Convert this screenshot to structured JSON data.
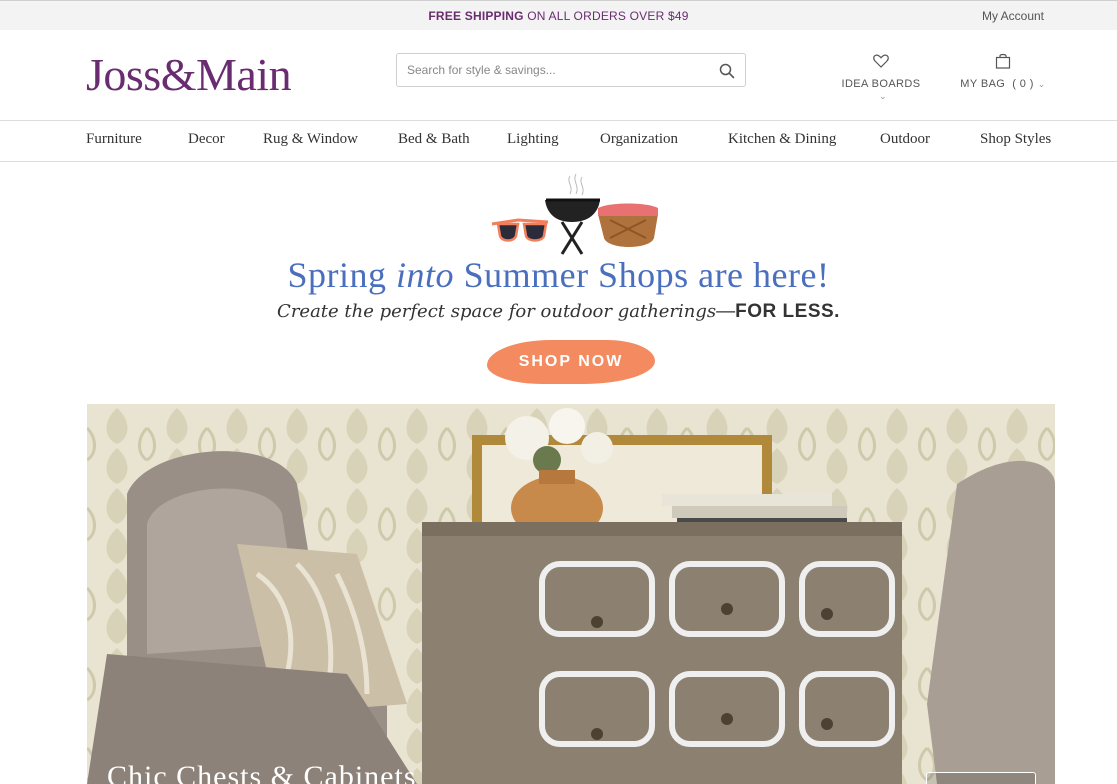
{
  "colors": {
    "brand": "#6a2c70",
    "hero_blue": "#4b6fbf",
    "shop_now": "#f48a5f"
  },
  "topbar": {
    "promo_bold": "FREE SHIPPING",
    "promo_rest": " ON ALL ORDERS OVER $49",
    "my_account": "My Account"
  },
  "header": {
    "logo": "Joss&Main",
    "search_placeholder": "Search for style & savings...",
    "search_icon": "search-icon",
    "idea_boards_label": "IDEA BOARDS",
    "idea_boards_icon": "heart-icon",
    "bag_label": "MY BAG",
    "bag_count": "( 0 )",
    "bag_icon": "shopping-bag-icon",
    "dropdown_icon": "chevron-down-icon"
  },
  "nav": {
    "items": [
      "Furniture",
      "Decor",
      "Rug & Window",
      "Bed & Bath",
      "Lighting",
      "Organization",
      "Kitchen & Dining",
      "Outdoor",
      "Shop Styles"
    ]
  },
  "hero": {
    "illustration": "sunglasses-grill-basket-illustration",
    "title_part1": "Spring ",
    "title_italic": "into",
    "title_part2": " Summer Shops are here!",
    "subtitle_italic": "Create the perfect space for outdoor gatherings",
    "subtitle_dash": "—",
    "subtitle_bold": "FOR LESS.",
    "cta": "SHOP NOW"
  },
  "feature": {
    "image": "armchair-and-chest-of-drawers-photo",
    "title": "Chic Chests & Cabinets"
  }
}
